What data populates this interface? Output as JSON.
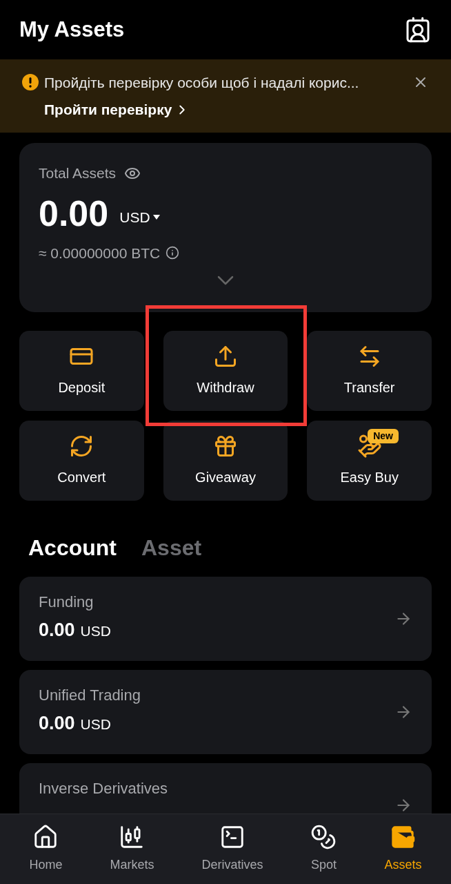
{
  "header": {
    "title": "My Assets"
  },
  "banner": {
    "message": "Пройдіть перевірку особи щоб і надалі корис...",
    "link": "Пройти перевірку"
  },
  "total": {
    "label": "Total Assets",
    "amount": "0.00",
    "currency": "USD",
    "btc": "≈ 0.00000000 BTC"
  },
  "actions": [
    {
      "label": "Deposit",
      "highlighted": false
    },
    {
      "label": "Withdraw",
      "highlighted": true
    },
    {
      "label": "Transfer",
      "highlighted": false
    },
    {
      "label": "Convert",
      "highlighted": false
    },
    {
      "label": "Giveaway",
      "highlighted": false
    },
    {
      "label": "Easy Buy",
      "highlighted": false,
      "badge": "New"
    }
  ],
  "tabs": [
    {
      "label": "Account",
      "selected": true
    },
    {
      "label": "Asset",
      "selected": false
    }
  ],
  "accounts": [
    {
      "name": "Funding",
      "amount": "0.00",
      "currency": "USD"
    },
    {
      "name": "Unified Trading",
      "amount": "0.00",
      "currency": "USD"
    },
    {
      "name": "Inverse Derivatives"
    }
  ],
  "nav": [
    {
      "label": "Home",
      "selected": false
    },
    {
      "label": "Markets",
      "selected": false
    },
    {
      "label": "Derivatives",
      "selected": false
    },
    {
      "label": "Spot",
      "selected": false
    },
    {
      "label": "Assets",
      "selected": true
    }
  ]
}
